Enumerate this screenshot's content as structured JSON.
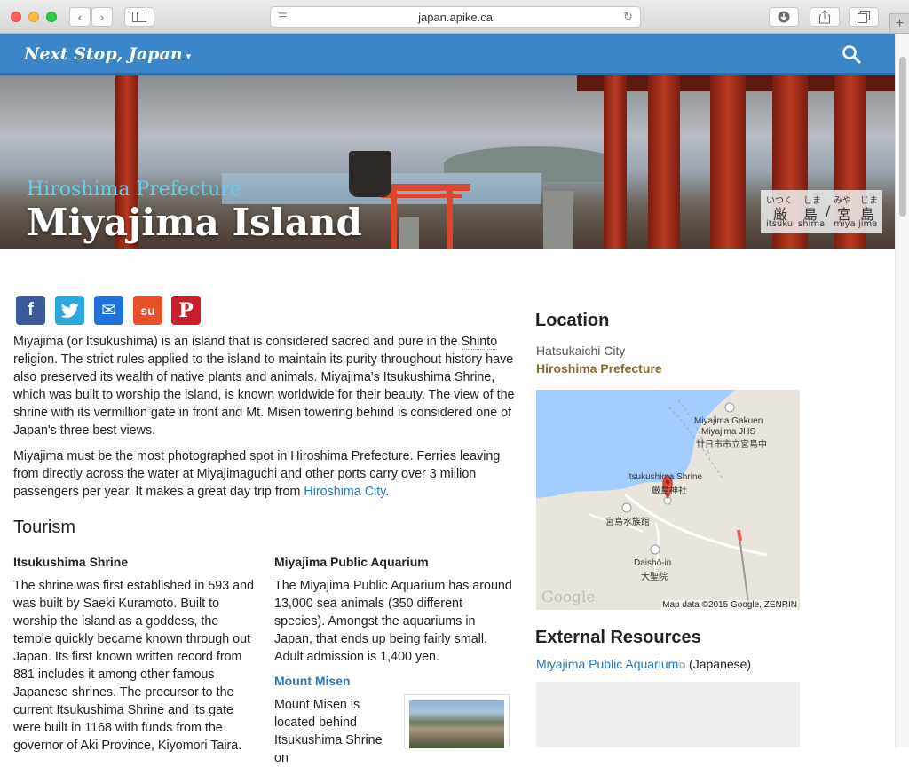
{
  "browser": {
    "url": "japan.apike.ca",
    "new_tab": "+"
  },
  "site": {
    "brand": "Next Stop, Japan",
    "brand_caret": "▾"
  },
  "hero": {
    "subtitle": "Hiroshima Prefecture",
    "title": "Miyajima Island",
    "ruby": {
      "top": [
        "いつく",
        "しま",
        "みや",
        "じま"
      ],
      "kanji": [
        "厳",
        "島",
        "/",
        "宮",
        "島"
      ],
      "romaji": [
        "itsuku",
        "shima",
        "miya",
        "jima"
      ]
    }
  },
  "share": [
    "f",
    "t",
    "✉",
    "su",
    "P"
  ],
  "intro": {
    "p1_a": "Miyajima (or Itsukushima) is an island that is considered sacred and pure in the",
    "p1_shinto": "Shinto",
    "p1_b": "religion. The strict rules applied to the island to maintain its purity throughout history have also preserved its wealth of native plants and animals. Miyajima's Itsukushima Shrine, which was built to worship the island, is known worldwide for their beauty. The view of the shrine with its vermillion gate in front and Mt. Misen towering behind is considered one of Japan's three best views.",
    "p2_a": "Miyajima must be the most photographed spot in Hiroshima Prefecture. Ferries leaving from directly across the water at Miyajimaguchi and other ports carry over 3 million passengers per year. It makes a great day trip from",
    "p2_link": "Hiroshima City",
    "p2_end": "."
  },
  "tourism": {
    "heading": "Tourism",
    "shrine_title": "Itsukushima Shrine",
    "shrine_text": "The shrine was first established in 593 and was built by Saeki Kuramoto. Built to worship the island as a goddess, the temple quickly became known through out Japan. Its first known written record from 881 includes it among other famous Japanese shrines. The precursor to the current Itsukushima Shrine and its gate were built in 1168 with funds from the governor of Aki Province, Kiyomori Taira.",
    "aquarium_title": "Miyajima Public Aquarium",
    "aquarium_text": "The Miyajima Public Aquarium has around 13,000 sea animals (350 different species). Amongst the aquariums in Japan, that ends up being fairly small. Adult admission is 1,400 yen.",
    "misen_title": "Mount Misen",
    "misen_text": "Mount Misen is located behind Itsukushima Shrine on"
  },
  "sidebar": {
    "location_heading": "Location",
    "city": "Hatsukaichi City",
    "prefecture": "Hiroshima Prefecture",
    "map": {
      "label_school_en1": "Miyajima Gakuen",
      "label_school_en2": "Miyajima JHS",
      "label_school_jp": "廿日市市立宮島中",
      "label_shrine": "Itsukushima Shrine",
      "label_shrine_jp": "厳島神社",
      "label_inn": "宮島水族館",
      "label_daisho": "Daishō-in",
      "label_daisho_jp": "大聖院",
      "google": "Google",
      "credit": "Map data ©2015 Google, ZENRIN"
    },
    "external_heading": "External Resources",
    "external_link": "Miyajima Public Aquarium",
    "external_suffix": "(Japanese)"
  },
  "colors": {
    "nav_blue": "#3a86c8",
    "link_blue": "#2a77c0",
    "prefecture_brown": "#8a6a2a",
    "hero_subtitle": "#5fd0f0"
  }
}
